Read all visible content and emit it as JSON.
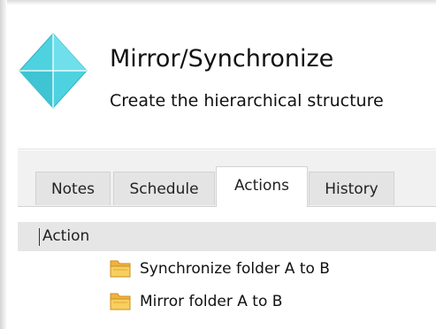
{
  "header": {
    "title": "Mirror/Synchronize",
    "subtitle": "Create the hierarchical structure",
    "icon": "diamond-icon",
    "icon_color": "#4fd2e0"
  },
  "tabs": [
    {
      "label": "Notes",
      "active": false
    },
    {
      "label": "Schedule",
      "active": false
    },
    {
      "label": "Actions",
      "active": true
    },
    {
      "label": "History",
      "active": false
    }
  ],
  "grid": {
    "column_header": "Action",
    "rows": [
      {
        "icon": "folder-icon",
        "label": "Synchronize folder A to B"
      },
      {
        "icon": "folder-icon",
        "label": "Mirror folder A to B"
      }
    ]
  },
  "colors": {
    "folder": "#f5c64f",
    "panel_background": "#f1f1f1",
    "tab_background": "#e4e4e4",
    "grid_header_background": "#e6e6e6"
  }
}
